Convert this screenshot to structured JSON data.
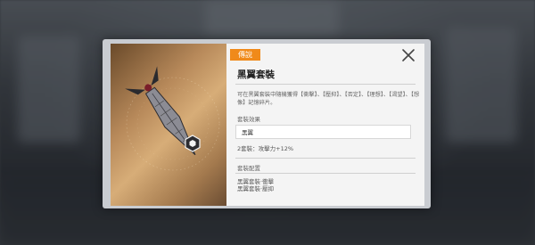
{
  "colors": {
    "accent": "#f08a1a",
    "panel_bg": "#f4f4f4",
    "art_gradient_mid": "#d7ad78"
  },
  "item": {
    "rarity": "傳說",
    "title": "黑翼套裝",
    "description": "可在黑翼套裝中隨機獲得【衝擊】、【壓抑】、【否定】、【理想】、【渴望】、【想像】記憶碎片。",
    "effect_section_label": "套裝效果",
    "effect_name": "黑翼",
    "bonus_text": "2套裝：攻擊力+12%",
    "parts_section_label": "套裝配置",
    "parts": [
      "黑翼套裝·衝擊",
      "黑翼套裝·壓抑"
    ],
    "icon": "black-wing-blade-icon",
    "set_emblem_icon": "hexagon-emblem-icon"
  },
  "close_icon": "close-icon"
}
